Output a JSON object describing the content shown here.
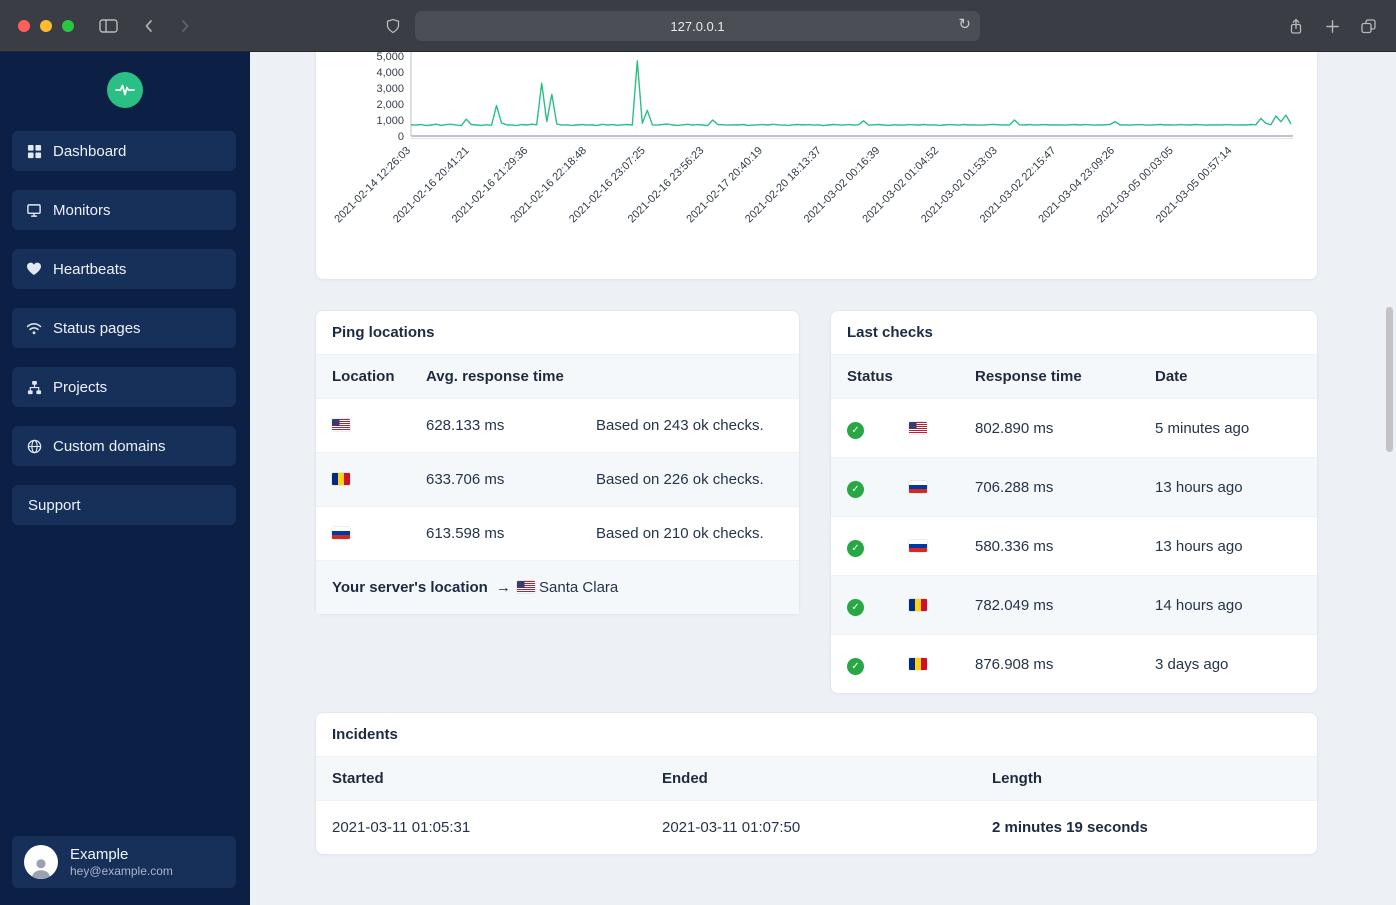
{
  "browser": {
    "url": "127.0.0.1",
    "icons": {
      "reload": "↻",
      "plus": "+"
    }
  },
  "colors": {
    "traffic_red": "#ff5f57",
    "traffic_yellow": "#febc2e",
    "traffic_green": "#28c840",
    "accent_green": "#2abf85",
    "status_ok_green": "#28a745",
    "sidebar_bg": "#0c1f44"
  },
  "sidebar": {
    "items": [
      {
        "label": "Dashboard",
        "icon": "grid-icon"
      },
      {
        "label": "Monitors",
        "icon": "monitor-icon"
      },
      {
        "label": "Heartbeats",
        "icon": "heart-icon"
      },
      {
        "label": "Status pages",
        "icon": "wifi-icon"
      },
      {
        "label": "Projects",
        "icon": "nodes-icon"
      },
      {
        "label": "Custom domains",
        "icon": "globe-icon"
      },
      {
        "label": "Support",
        "icon": "none"
      }
    ],
    "user": {
      "name": "Example",
      "email": "hey@example.com"
    }
  },
  "chart_data": {
    "type": "line",
    "title": "",
    "ylabel": "",
    "xlabel": "",
    "ylim": [
      0,
      5000
    ],
    "y_tick_labels": [
      "0",
      "1,000",
      "2,000",
      "3,000",
      "4,000",
      "5,000"
    ],
    "line_color": "#2abf85",
    "legend": "off",
    "grid": "off",
    "x_labels": [
      "2021-02-14 12:26:03",
      "2021-02-16 20:41:21",
      "2021-02-16 21:29:36",
      "2021-02-16 22:18:48",
      "2021-02-16 23:07:25",
      "2021-02-16 23:56:23",
      "2021-02-17 20:40:19",
      "2021-02-20 18:13:37",
      "2021-03-02 00:16:39",
      "2021-03-02 01:04:52",
      "2021-03-02 01:53:03",
      "2021-03-02 22:15:47",
      "2021-03-04 23:09:26",
      "2021-03-05 00:03:05",
      "2021-03-05 00:57:14"
    ],
    "values": [
      700,
      680,
      720,
      650,
      690,
      740,
      660,
      710,
      730,
      680,
      650,
      1050,
      720,
      690,
      660,
      700,
      670,
      1900,
      820,
      700,
      680,
      650,
      720,
      690,
      740,
      700,
      3300,
      900,
      2600,
      750,
      680,
      700,
      660,
      690,
      720,
      680,
      700,
      650,
      730,
      690,
      710,
      670,
      700,
      720,
      690,
      4700,
      800,
      1600,
      700,
      680,
      720,
      750,
      690,
      660,
      700,
      730,
      680,
      710,
      690,
      650,
      1000,
      720,
      700,
      680,
      700,
      690,
      720,
      660,
      680,
      700,
      710,
      690,
      730,
      700,
      680,
      660,
      700,
      720,
      690,
      710,
      680,
      700,
      650,
      690,
      720,
      700,
      680,
      710,
      690,
      700,
      950,
      680,
      700,
      720,
      690,
      660,
      700,
      690,
      680,
      710,
      700,
      690,
      720,
      680,
      700,
      660,
      690,
      710,
      700,
      680,
      720,
      690,
      700,
      680,
      690,
      710,
      720,
      700,
      690,
      680,
      1000,
      700,
      690,
      720,
      680,
      700,
      710,
      690,
      700,
      690,
      680,
      700,
      720,
      690,
      710,
      700,
      680,
      690,
      700,
      720,
      900,
      690,
      700,
      680,
      700,
      710,
      690,
      680,
      700,
      720,
      690,
      700,
      680,
      710,
      700,
      690,
      720,
      700,
      680,
      690,
      700,
      690,
      710,
      700,
      680,
      700,
      690,
      720,
      700,
      1100,
      800,
      700,
      1250,
      900,
      1300,
      750
    ]
  },
  "ping_locations": {
    "title": "Ping locations",
    "columns": [
      "Location",
      "Avg. response time"
    ],
    "rows": [
      {
        "flag": "us",
        "avg": "628.133 ms",
        "note": "Based on 243 ok checks."
      },
      {
        "flag": "ro",
        "avg": "633.706 ms",
        "note": "Based on 226 ok checks."
      },
      {
        "flag": "ru",
        "avg": "613.598 ms",
        "note": "Based on 210 ok checks."
      }
    ],
    "footer": {
      "label": "Your server's location",
      "arrow": "→",
      "flag": "us",
      "city": "Santa Clara"
    }
  },
  "last_checks": {
    "title": "Last checks",
    "columns": [
      "Status",
      "Response time",
      "Date"
    ],
    "rows": [
      {
        "status": "ok",
        "flag": "us",
        "response": "802.890 ms",
        "date": "5 minutes ago"
      },
      {
        "status": "ok",
        "flag": "ru",
        "response": "706.288 ms",
        "date": "13 hours ago"
      },
      {
        "status": "ok",
        "flag": "ru",
        "response": "580.336 ms",
        "date": "13 hours ago"
      },
      {
        "status": "ok",
        "flag": "ro",
        "response": "782.049 ms",
        "date": "14 hours ago"
      },
      {
        "status": "ok",
        "flag": "ro",
        "response": "876.908 ms",
        "date": "3 days ago"
      }
    ],
    "check_glyph": "✓"
  },
  "incidents": {
    "title": "Incidents",
    "columns": [
      "Started",
      "Ended",
      "Length"
    ],
    "rows": [
      {
        "started": "2021-03-11 01:05:31",
        "ended": "2021-03-11 01:07:50",
        "length": "2 minutes 19 seconds"
      }
    ]
  }
}
